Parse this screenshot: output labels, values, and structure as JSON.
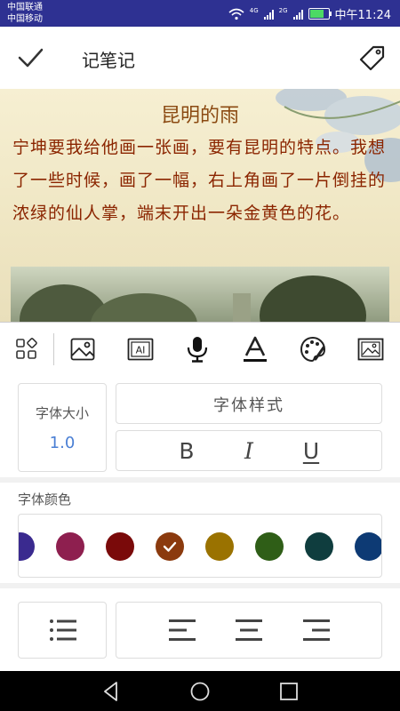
{
  "status_bar": {
    "carrier_1": "中国联通",
    "carrier_2": "中国移动",
    "net_1": "4G",
    "net_2": "2G",
    "battery_level": 0.85,
    "time": "中午11:24"
  },
  "header": {
    "title": "记笔记",
    "confirm_icon": "check-icon",
    "tag_icon": "tag-icon"
  },
  "note": {
    "title": "昆明的雨",
    "body": "宁坤要我给他画一张画，要有昆明的特点。我想了一些时候，画了一幅，右上角画了一片倒挂的浓绿的仙人掌，端末开出一朵金黄色的花。"
  },
  "toolbar": {
    "items": [
      "apps-icon",
      "image-icon",
      "ai-icon",
      "microphone-icon",
      "text-format-icon",
      "palette-icon",
      "picture-frame-icon"
    ]
  },
  "panel": {
    "font_size_label": "字体大小",
    "font_size_value": "1.0",
    "font_style_label": "字体样式",
    "bold_label": "B",
    "italic_label": "I",
    "underline_label": "U",
    "font_color_label": "字体颜色",
    "colors": [
      "#3a2a8f",
      "#8e1f4f",
      "#7a0a0a",
      "#8b3a0e",
      "#9a7200",
      "#2f5e17",
      "#0f3d3e",
      "#0d3a74"
    ],
    "selected_color_index": 3,
    "list_icon": "bullet-list-icon",
    "align_icons": [
      "align-left-icon",
      "align-center-icon",
      "align-right-icon"
    ]
  },
  "nav_bar": {
    "items": [
      "back-icon",
      "home-icon",
      "recents-icon"
    ]
  }
}
